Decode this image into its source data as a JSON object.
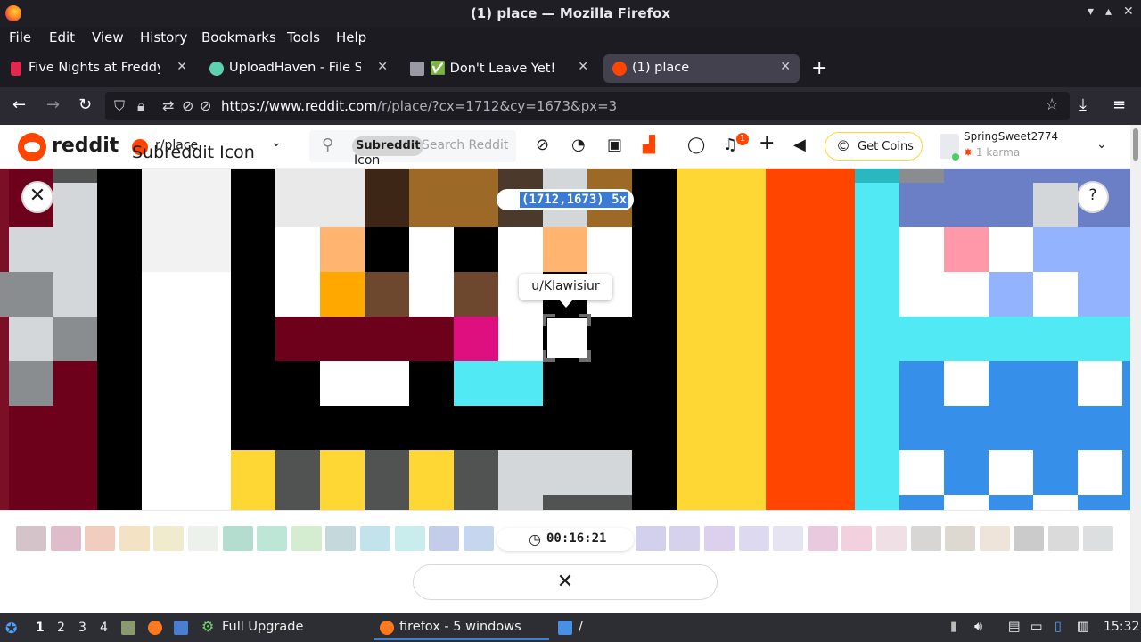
{
  "window": {
    "title": "(1) place — Mozilla Firefox"
  },
  "menu": [
    "File",
    "Edit",
    "View",
    "History",
    "Bookmarks",
    "Tools",
    "Help"
  ],
  "tabs": [
    {
      "label": "Five Nights at Freddy's: S",
      "favicon": "lock-icon",
      "color": "#e22850"
    },
    {
      "label": "UploadHaven - File Sharin",
      "favicon": "cloud-icon",
      "color": "#5fd0b0"
    },
    {
      "label": "✅ Don't Leave Yet!",
      "favicon": "page-icon",
      "color": "#9a9aa6"
    },
    {
      "label": "(1) place",
      "favicon": "reddit-icon",
      "color": "#ff4500"
    }
  ],
  "nav": {
    "url_host": "https://www.reddit.com",
    "url_path": "/r/place/?cx=1712&cy=1673&px=3"
  },
  "reddit": {
    "logo_text": "reddit",
    "subreddit": "r/place",
    "subreddit_alt": "Subreddit Icon",
    "search_chip": "Subreddit",
    "search_chip_alt": "Icon",
    "search_placeholder": "Search Reddit",
    "notification_count": "1",
    "coins_label": "Get Coins",
    "username": "SpringSweet2774",
    "karma": "1 karma"
  },
  "place": {
    "coordinates": "(1712,1673) 5x",
    "selected_user": "u/Klawisiur",
    "cooldown": "00:16:21",
    "cancel_symbol": "✕",
    "palette": [
      "#d4c3c8",
      "#dfbcca",
      "#f0cdbf",
      "#f3e2c3",
      "#f0ebcc",
      "#ecf1ec",
      "#b5ddcf",
      "#bde6d6",
      "#d4ecd0",
      "#c4d9db",
      "#c2e3ec",
      "#c9ecec",
      "#c3cde9",
      "#c6d6ef",
      "#d3d0ee",
      "#d6d1ec",
      "#ddd0ee",
      "#ddd9f0",
      "#e6e4f3",
      "#e8c9de",
      "#f2d0de",
      "#f0dfe5",
      "#d8d6d4",
      "#ddd8d0",
      "#eee4d9",
      "#cbcbcb",
      "#dadada",
      "#dbdfe0",
      "#e7e7ea",
      "#eeeeef"
    ]
  },
  "taskbar": {
    "workspaces": [
      "1",
      "2",
      "3",
      "4"
    ],
    "active_workspace": "1",
    "upgrade_label": "Full Upgrade",
    "firefox_task": "firefox - 5 windows",
    "folder_task": "/",
    "clock": "15:32"
  }
}
